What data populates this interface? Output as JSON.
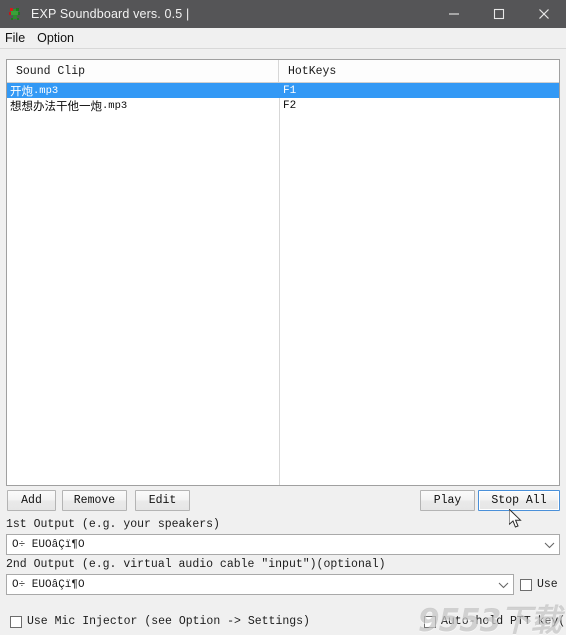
{
  "window": {
    "title": "EXP Soundboard vers. 0.5 |",
    "icon": "app-icon",
    "controls": {
      "minimize": "minimize-icon",
      "maximize": "maximize-icon",
      "close": "close-icon"
    },
    "titlebar_color": "#555557"
  },
  "menubar": {
    "items": [
      {
        "label": "File"
      },
      {
        "label": "Option"
      }
    ]
  },
  "list": {
    "columns": [
      "Sound Clip",
      "HotKeys"
    ],
    "selection_color": "#3399f5",
    "rows": [
      {
        "name": "开炮",
        "ext": ".mp3",
        "hotkey": "F1",
        "selected": true
      },
      {
        "name": "想想办法干他一炮",
        "ext": ".mp3",
        "hotkey": "F2",
        "selected": false
      }
    ]
  },
  "buttons": {
    "add": "Add",
    "remove": "Remove",
    "edit": "Edit",
    "play": "Play",
    "stop_all": "Stop All"
  },
  "outputs": {
    "first": {
      "label": "1st Output (e.g. your speakers)",
      "value": "Õ÷ ÊÙÓâÇï¶Ó"
    },
    "second": {
      "label": "2nd Output (e.g. virtual audio cable \"input\")(optional)",
      "value": "Õ÷ ÊÙÓâÇï¶Ó",
      "use_label": "Use",
      "use_checked": false
    }
  },
  "options": {
    "mic_injector": {
      "label": "Use Mic Injector (see Option -> Settings)",
      "checked": false
    },
    "auto_hold_ptt": {
      "label": "Auto-hold PTT key(s)",
      "checked": false
    }
  },
  "watermark": {
    "text": "9553下载"
  },
  "cursor": {
    "name": "mouse-pointer"
  }
}
